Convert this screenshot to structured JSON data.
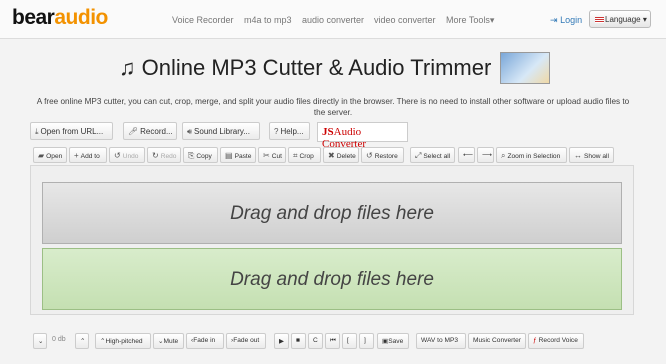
{
  "nav": {
    "logo_part1": "bear",
    "logo_part2": "audio",
    "links": [
      "Voice Recorder",
      "m4a to mp3",
      "audio converter",
      "video converter",
      "More Tools"
    ],
    "login": "Login",
    "language": "Language"
  },
  "header": {
    "title": "Online MP3 Cutter & Audio Trimmer",
    "description": "A free online MP3 cutter, you can cut, crop, merge, and split your audio files directly in the browser. There is no need to install other software or upload audio files to the server."
  },
  "actions": {
    "open_from_url": "Open from URL...",
    "record": "Record...",
    "sound_library": "Sound Library...",
    "help": "Help...",
    "js_prefix": "JS",
    "js_rest": "Audio Converter"
  },
  "toolbar": {
    "open": "Open",
    "add_to": "Add to",
    "undo": "Undo",
    "redo": "Redo",
    "copy": "Copy",
    "paste": "Paste",
    "cut": "Cut",
    "crop": "Crop",
    "delete": "Delete",
    "restore": "Restore",
    "select_all": "Select all",
    "zoom_in_selection": "Zoom in Selection",
    "show_all": "Show all"
  },
  "drop": {
    "first": "Drag and drop files here",
    "second": "Drag and drop files here"
  },
  "bottom": {
    "db": "0 db",
    "high_pitched": "High-pitched",
    "mute": "Mute",
    "fade_in": "Fade in",
    "fade_out": "Fade out",
    "save": "Save",
    "wav_to_mp3": "WAV to MP3",
    "music_converter": "Music Converter",
    "record_voice": "Record Voice"
  }
}
